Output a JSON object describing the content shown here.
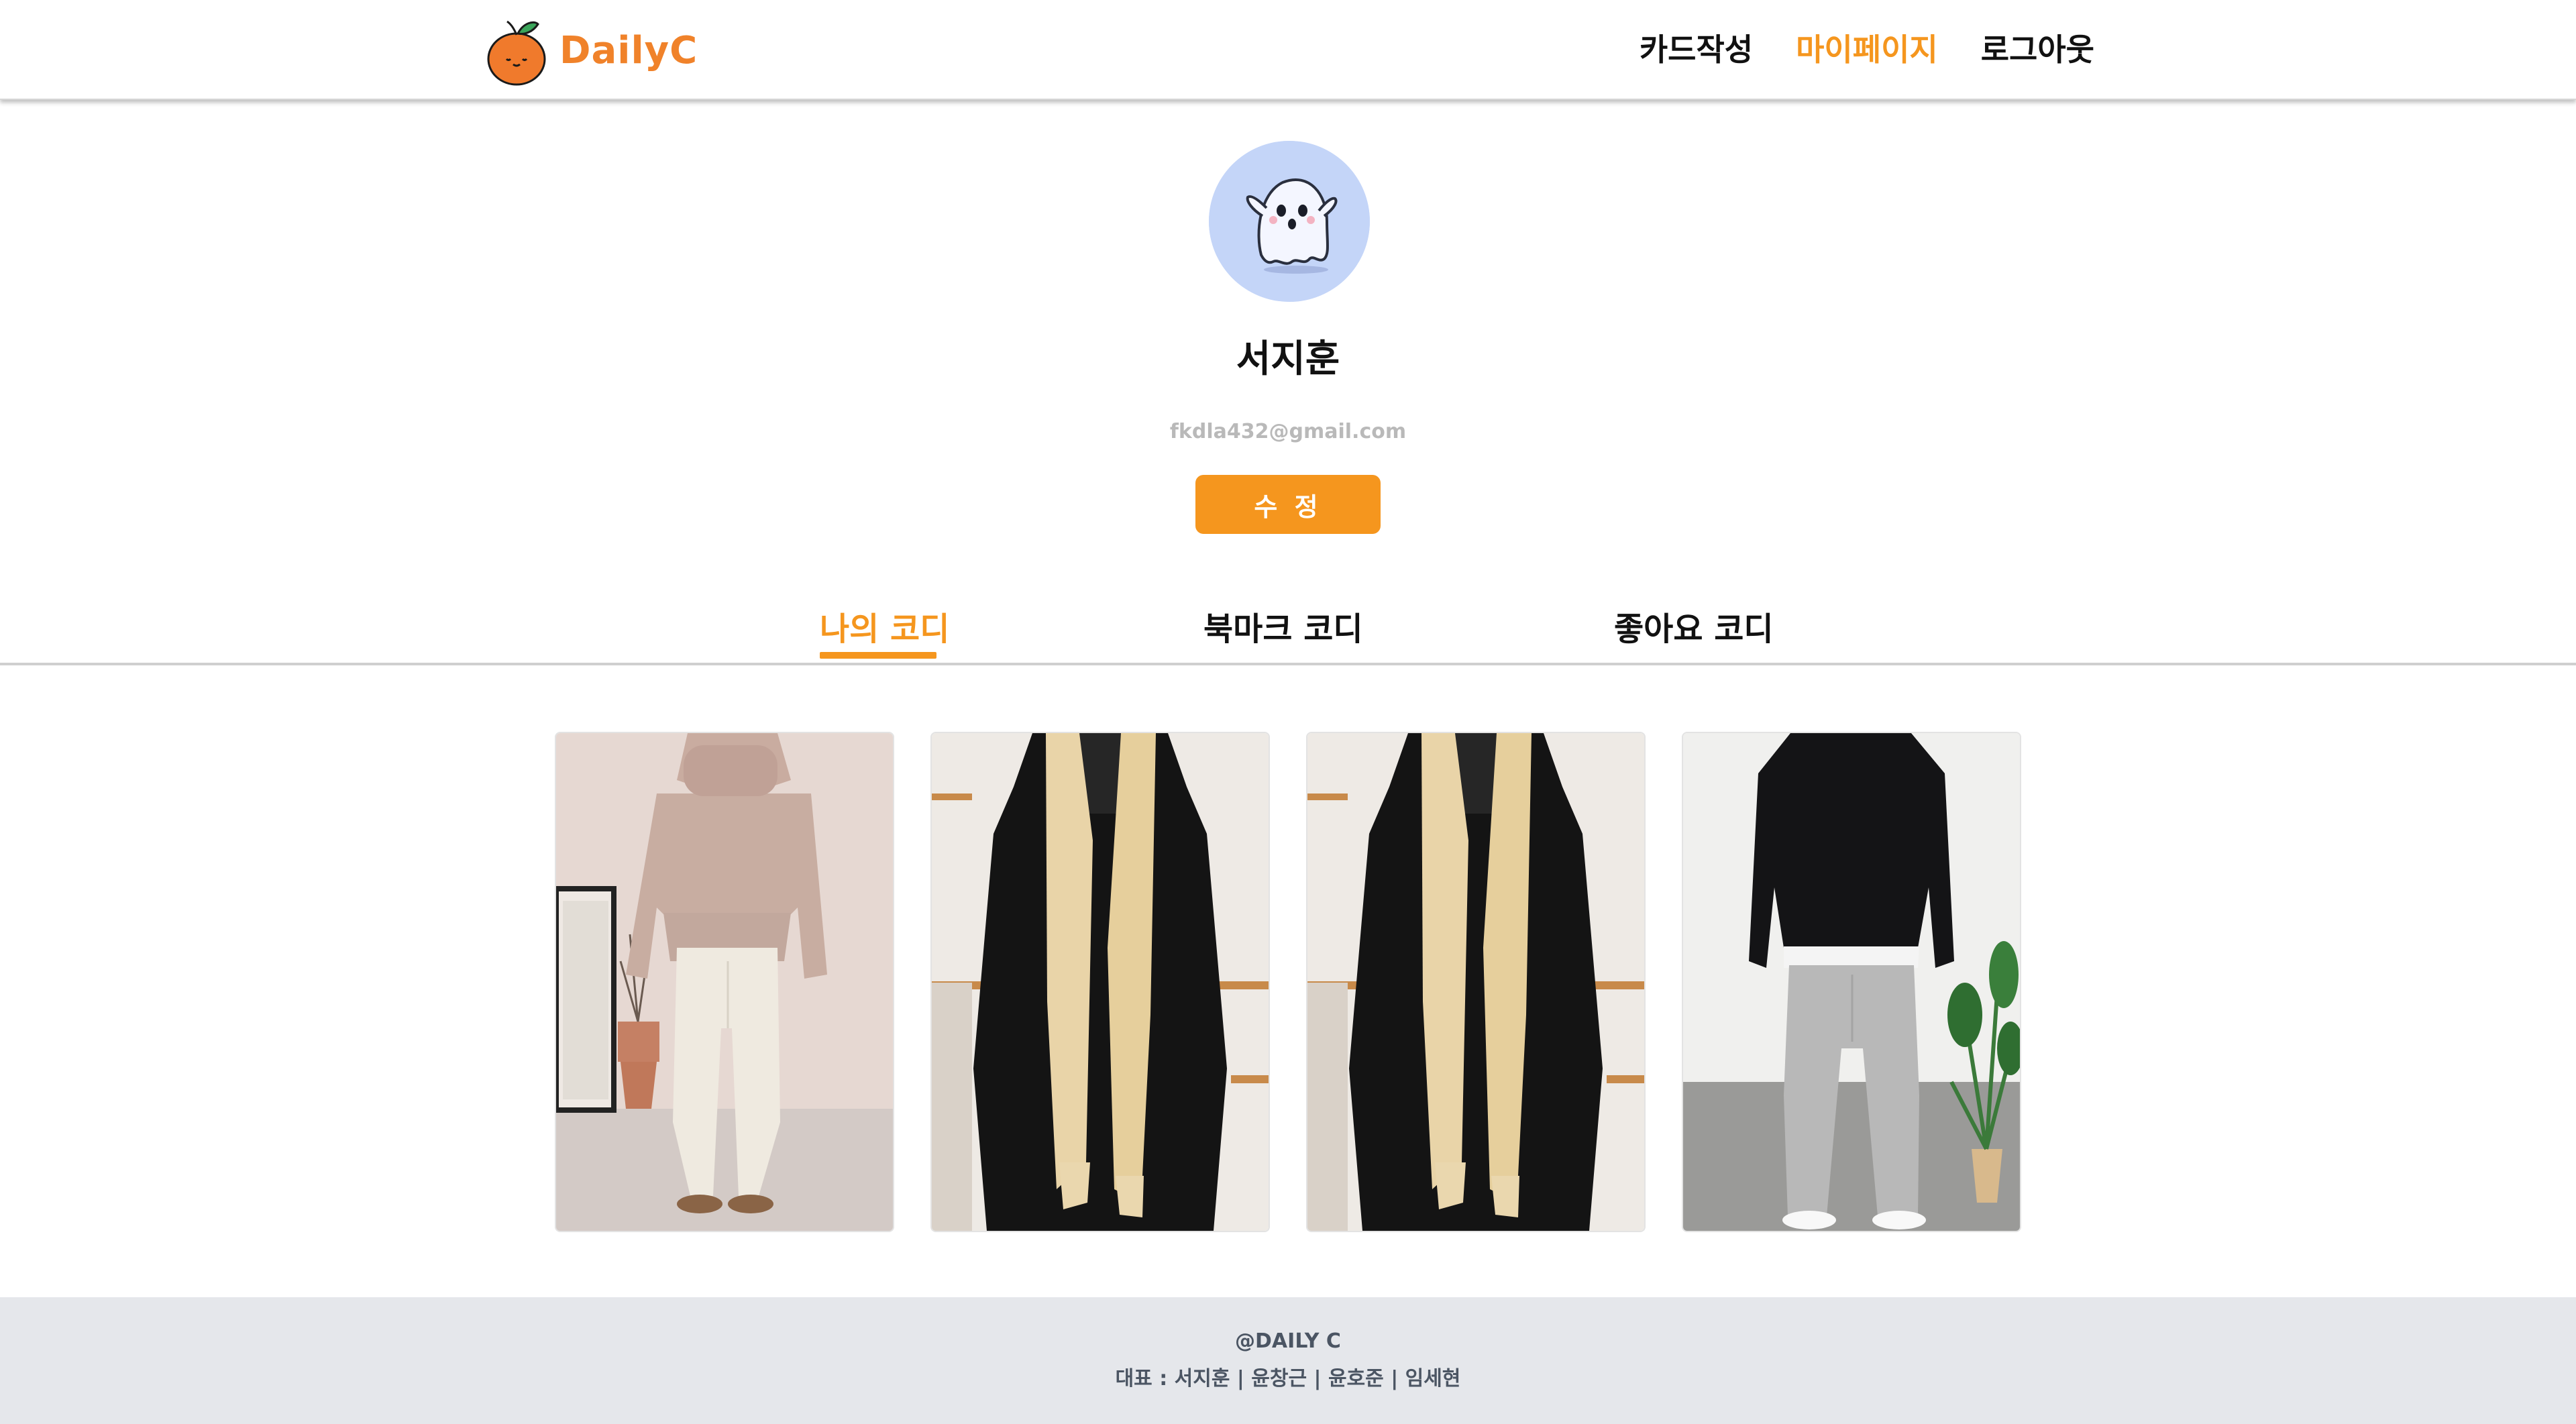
{
  "header": {
    "logo_text": "DailyC",
    "nav": {
      "create_card": "카드작성",
      "my_page": "마이페이지",
      "logout": "로그아웃"
    }
  },
  "profile": {
    "name": "서지훈",
    "email": "fkdla432@gmail.com",
    "edit_label": "수 정"
  },
  "tabs": {
    "my_codi": "나의 코디",
    "bookmark_codi": "북마크 코디",
    "like_codi": "좋아요 코디",
    "active": "my_codi"
  },
  "cards": [
    {
      "outfit": "beige turtleneck knit and cream slacks"
    },
    {
      "outfit": "black coat with beige scarf"
    },
    {
      "outfit": "black coat with beige scarf"
    },
    {
      "outfit": "black sweatshirt and grey sweatpants"
    }
  ],
  "footer": {
    "brand": "@DAILY C",
    "representatives": "대표 : 서지훈 | 윤창근 | 윤호준 | 임세현"
  },
  "colors": {
    "accent": "#f5961e",
    "logo": "#f0822a",
    "avatar_bg": "#c4d5f8",
    "footer_bg": "#e5e7eb",
    "footer_text": "#4b5563"
  }
}
